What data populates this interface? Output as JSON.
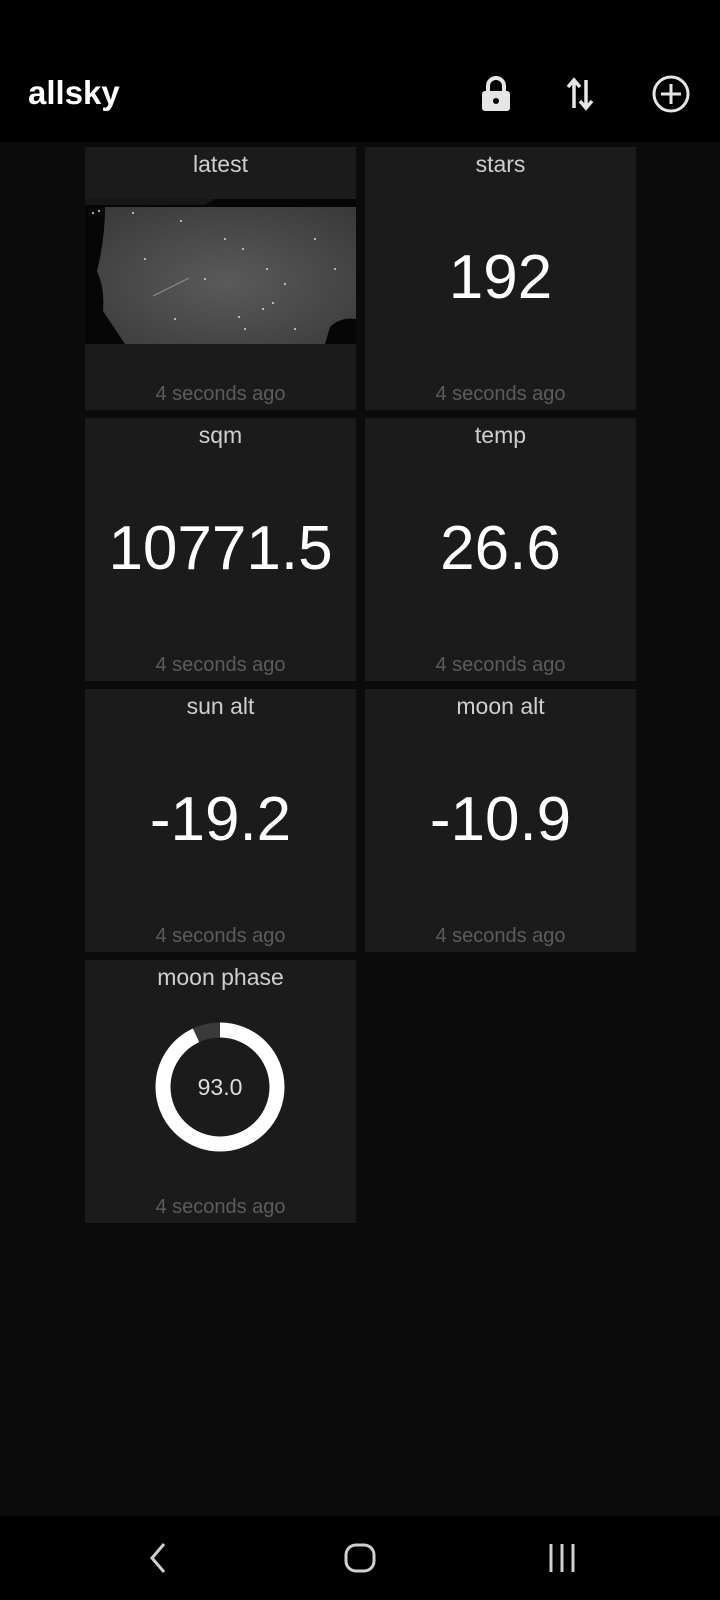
{
  "app_bar": {
    "title": "allsky",
    "icons": [
      "lock-icon",
      "swap-vertical-icon",
      "add-circle-icon"
    ]
  },
  "tiles": [
    {
      "title": "latest",
      "type": "image",
      "timestamp": "4 seconds ago"
    },
    {
      "title": "stars",
      "value": "192",
      "timestamp": "4 seconds ago"
    },
    {
      "title": "sqm",
      "value": "10771.5",
      "timestamp": "4 seconds ago"
    },
    {
      "title": "temp",
      "value": "26.6",
      "timestamp": "4 seconds ago"
    },
    {
      "title": "sun alt",
      "value": "-19.2",
      "timestamp": "4 seconds ago"
    },
    {
      "title": "moon alt",
      "value": "-10.9",
      "timestamp": "4 seconds ago"
    },
    {
      "title": "moon phase",
      "type": "gauge",
      "value": "93.0",
      "fraction": 0.93,
      "timestamp": "4 seconds ago"
    }
  ],
  "nav_bar": {
    "icons": [
      "back-icon",
      "home-icon",
      "recents-icon"
    ]
  },
  "colors": {
    "background": "#0b0b0b",
    "tile": "#1b1b1b",
    "bar": "#000000",
    "text": "#ffffff",
    "muted": "#5c5c5c"
  }
}
